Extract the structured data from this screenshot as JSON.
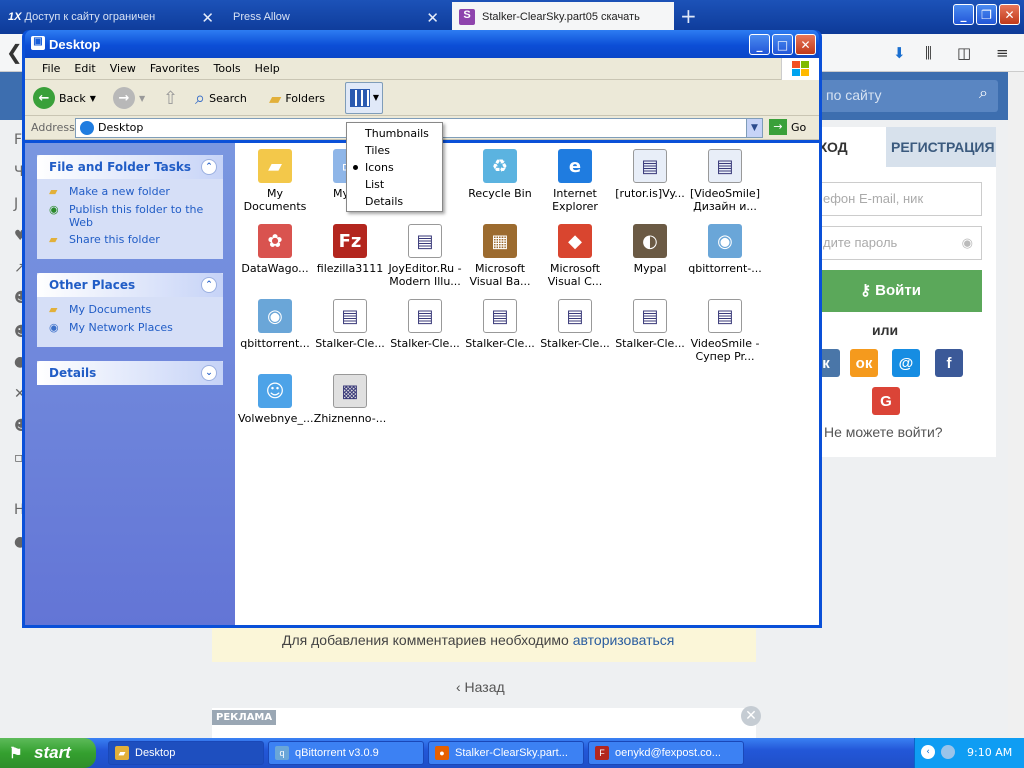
{
  "firefox": {
    "tabs": [
      {
        "title": "Доступ к сайту ограничен",
        "icon": "1X"
      },
      {
        "title": "Press Allow",
        "icon": ""
      },
      {
        "title": "Stalker-ClearSky.part05 скачать",
        "icon": "S"
      }
    ],
    "tab_close": "✕",
    "new_tab": "+"
  },
  "site": {
    "search_placeholder": "к по сайту",
    "login_tab": "ХОД",
    "register_tab": "РЕГИСТРАЦИЯ",
    "phone_placeholder": "ефон  E-mail, ник",
    "password_placeholder": "дите пароль",
    "login_button": "Войти",
    "or": "или",
    "social": [
      "к",
      "ок",
      "@",
      "f",
      "G"
    ],
    "cant_login": "Не можете войти?",
    "comment_text": "Для добавления комментариев необходимо",
    "comment_link": "авторизоваться",
    "back": "‹  Назад",
    "ad_label": "РЕКЛАМА",
    "ad_close": "✕",
    "left_letters": [
      "F",
      "Ч",
      "Ј",
      "♥",
      "↗",
      "☻",
      "☻",
      "●",
      "✕",
      "☻",
      "▫",
      "H",
      "●"
    ]
  },
  "explorer": {
    "title": "Desktop",
    "menu": [
      "File",
      "Edit",
      "View",
      "Favorites",
      "Tools",
      "Help"
    ],
    "toolbar": {
      "back": "Back",
      "search": "Search",
      "folders": "Folders"
    },
    "address_label": "Address",
    "address_value": "Desktop",
    "go": "Go",
    "views_menu": [
      "Thumbnails",
      "Tiles",
      "Icons",
      "List",
      "Details"
    ],
    "views_selected": "Icons",
    "file_tasks": {
      "title": "File and Folder Tasks",
      "items": [
        "Make a new folder",
        "Publish this folder to the Web",
        "Share this folder"
      ]
    },
    "other_places": {
      "title": "Other Places",
      "items": [
        "My Documents",
        "My Network Places"
      ]
    },
    "details": {
      "title": "Details"
    },
    "files": [
      {
        "l1": "My Documents",
        "l2": "",
        "icon": "folder",
        "color": "#f3c84a"
      },
      {
        "l1": "My Co",
        "l2": "",
        "icon": "computer",
        "color": "#8fb6e8"
      },
      {
        "l1": "ork",
        "l2": "",
        "icon": "network",
        "color": "#7aa0d8"
      },
      {
        "l1": "Recycle Bin",
        "l2": "",
        "icon": "recycle",
        "color": "#5bb3e0"
      },
      {
        "l1": "Internet",
        "l2": "Explorer",
        "icon": "ie",
        "color": "#1f7ce0"
      },
      {
        "l1": "[rutor.is]Vy...",
        "l2": "",
        "icon": "file",
        "color": "#e8eef8"
      },
      {
        "l1": "[VideoSmile]",
        "l2": "Дизайн и...",
        "icon": "file",
        "color": "#e8eef8"
      },
      {
        "l1": "DataWago...",
        "l2": "",
        "icon": "flower",
        "color": "#d9534f"
      },
      {
        "l1": "filezilla3111",
        "l2": "",
        "icon": "fz",
        "color": "#b3261e"
      },
      {
        "l1": "JoyEditor.Ru -",
        "l2": "Modern Illu...",
        "icon": "doc",
        "color": "#ffffff"
      },
      {
        "l1": "Microsoft",
        "l2": "Visual Ba...",
        "icon": "vb",
        "color": "#9c6b2f"
      },
      {
        "l1": "Microsoft",
        "l2": "Visual C...",
        "icon": "vc",
        "color": "#d9452f"
      },
      {
        "l1": "Mypal",
        "l2": "",
        "icon": "raccoon",
        "color": "#6b5a44"
      },
      {
        "l1": "qbittorrent-...",
        "l2": "",
        "icon": "installer",
        "color": "#6aa6d8"
      },
      {
        "l1": "qbittorrent...",
        "l2": "",
        "icon": "installer",
        "color": "#6aa6d8"
      },
      {
        "l1": "Stalker-Cle...",
        "l2": "",
        "icon": "doc",
        "color": "#ffffff"
      },
      {
        "l1": "Stalker-Cle...",
        "l2": "",
        "icon": "doc",
        "color": "#ffffff"
      },
      {
        "l1": "Stalker-Cle...",
        "l2": "",
        "icon": "doc",
        "color": "#ffffff"
      },
      {
        "l1": "Stalker-Cle...",
        "l2": "",
        "icon": "doc",
        "color": "#ffffff"
      },
      {
        "l1": "Stalker-Cle...",
        "l2": "",
        "icon": "doc",
        "color": "#ffffff"
      },
      {
        "l1": "VideoSmile -",
        "l2": "Супер Pr...",
        "icon": "doc",
        "color": "#ffffff"
      },
      {
        "l1": "Volwebnye_...",
        "l2": "",
        "icon": "smiley",
        "color": "#4da3e8"
      },
      {
        "l1": "Zhiznenno-...",
        "l2": "",
        "icon": "image",
        "color": "#e0e0e0"
      }
    ]
  },
  "taskbar": {
    "start": "start",
    "tasks": [
      {
        "label": "Desktop",
        "icon": "folder"
      },
      {
        "label": "qBittorrent v3.0.9",
        "icon": "qb"
      },
      {
        "label": "Stalker-ClearSky.part...",
        "icon": "ff"
      },
      {
        "label": "oenykd@fexpost.co...",
        "icon": "fz"
      }
    ],
    "clock": "9:10 AM"
  }
}
